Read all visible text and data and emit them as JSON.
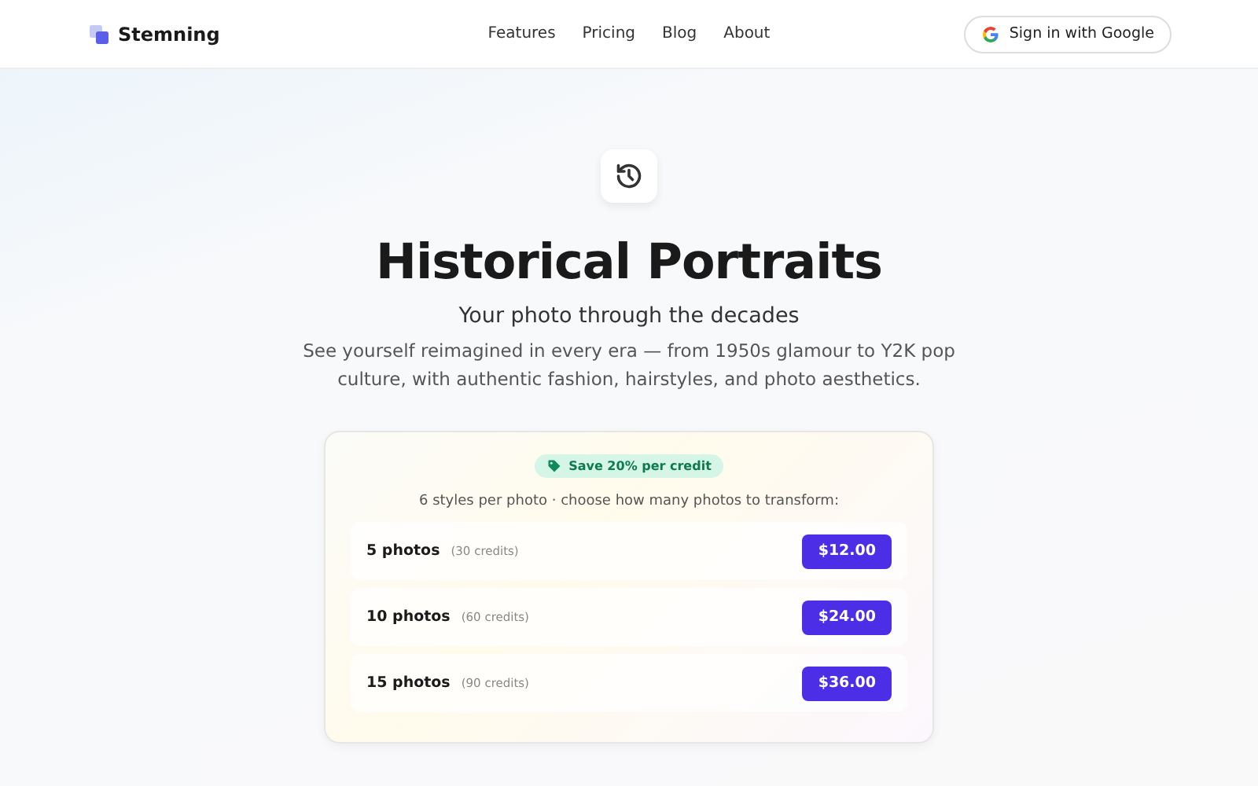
{
  "brand": {
    "name": "Stemning"
  },
  "nav": [
    "Features",
    "Pricing",
    "Blog",
    "About"
  ],
  "sign_in": {
    "label": "Sign in with Google"
  },
  "hero": {
    "title": "Historical Portraits",
    "subtitle": "Your photo through the decades",
    "description": "See yourself reimagined in every era — from 1950s glamour to Y2K pop culture, with authentic fashion, hairstyles, and photo aesthetics."
  },
  "pricing": {
    "badge": "Save 20% per credit",
    "note": "6 styles per photo · choose how many photos to transform:",
    "options": [
      {
        "label": "5 photos",
        "credits": "(30 credits)",
        "price": "$12.00"
      },
      {
        "label": "10 photos",
        "credits": "(60 credits)",
        "price": "$24.00"
      },
      {
        "label": "15 photos",
        "credits": "(90 credits)",
        "price": "$36.00"
      }
    ]
  }
}
